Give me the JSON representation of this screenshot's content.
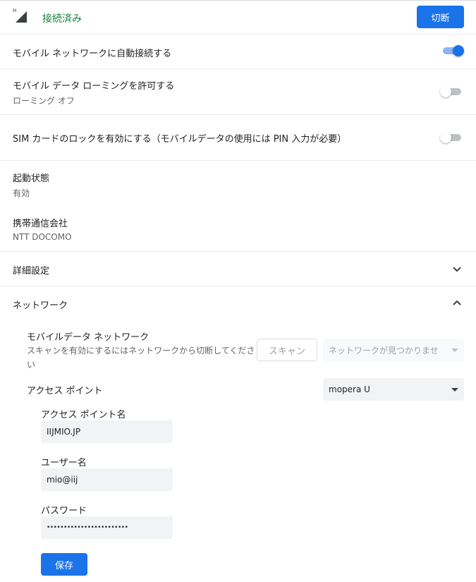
{
  "header": {
    "signal_icon": "cell-signal-icon",
    "signal_badge": "H",
    "status": "接続済み",
    "disconnect_label": "切断",
    "colors": {
      "status_green": "#188038",
      "accent": "#1a73e8"
    }
  },
  "settings": {
    "auto_connect": {
      "label": "モバイル ネットワークに自動接続する",
      "enabled": true
    },
    "roaming": {
      "label": "モバイル データ ローミングを許可する",
      "sublabel": "ローミング オフ",
      "enabled": false
    },
    "sim_lock": {
      "label": "SIM カードのロックを有効にする（モバイルデータの使用には PIN 入力が必要）",
      "enabled": false
    }
  },
  "info": {
    "activation": {
      "label": "起動状態",
      "value": "有効"
    },
    "carrier": {
      "label": "携帯通信会社",
      "value": "NTT DOCOMO"
    }
  },
  "advanced": {
    "label": "詳細設定",
    "icon": "chevron-down-icon"
  },
  "network": {
    "label": "ネットワーク",
    "icon": "chevron-up-icon",
    "mobile_data": {
      "label": "モバイルデータ ネットワーク",
      "hint": "スキャンを有効にするにはネットワークから切断してください",
      "scan_label": "スキャン",
      "select_value": "ネットワークが見つかりませ"
    },
    "access_point": {
      "label": "アクセス ポイント",
      "select_value": "mopera U",
      "apn_label": "アクセス ポイント名",
      "apn_value": "IIJMIO.JP",
      "user_label": "ユーザー名",
      "user_value": "mio@iij",
      "password_label": "パスワード",
      "password_value": "••••••••••••••••••••••••",
      "save_label": "保存"
    }
  }
}
